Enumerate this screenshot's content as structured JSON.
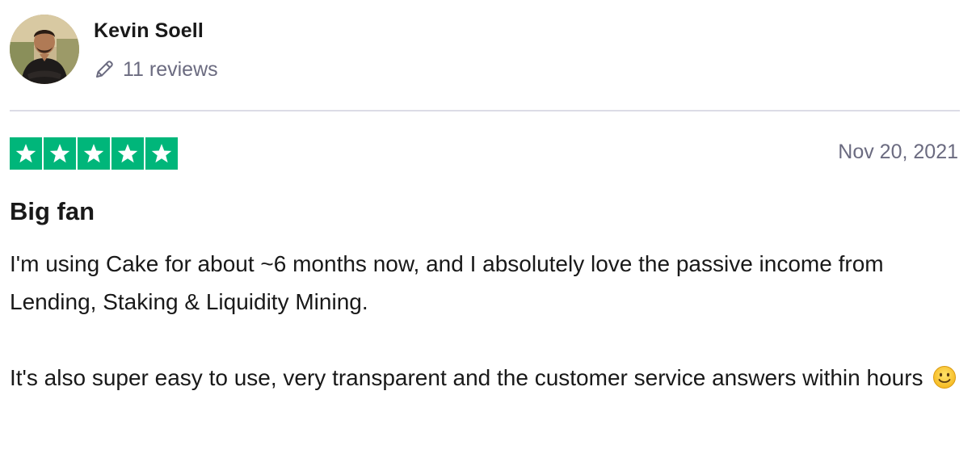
{
  "reviewer": {
    "name": "Kevin Soell",
    "reviews_count": "11 reviews",
    "avatar_icon": "avatar-photo"
  },
  "rating": {
    "stars": 5,
    "max": 5,
    "color": "#00b67a"
  },
  "review": {
    "date": "Nov 20, 2021",
    "title": "Big fan",
    "paragraph_1": "I'm using Cake for about ~6 months now, and I absolutely love the passive income from Lending, Staking & Liquidity Mining.",
    "paragraph_2": "It's also super easy to use, very transparent and the customer service answers within hours"
  },
  "icons": [
    "pencil-icon",
    "star-icon",
    "smiley-icon"
  ]
}
